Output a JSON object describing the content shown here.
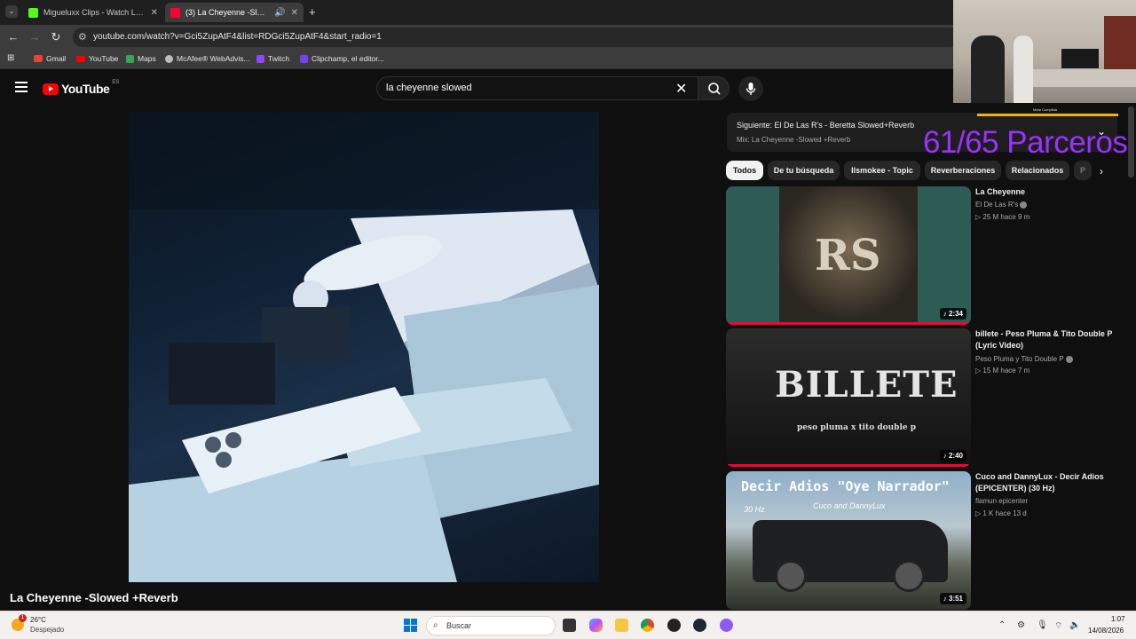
{
  "browser": {
    "tabs": [
      {
        "label": "Migueluxx Clips - Watch Live o",
        "color": "#53fc18"
      },
      {
        "label": "(3) La Cheyenne -Slowed +",
        "color": "#ff0033"
      }
    ],
    "new_tab": "+",
    "url": "youtube.com/watch?v=Gci5ZupAtF4&list=RDGci5ZupAtF4&start_radio=1",
    "bookmarks": [
      "Gmail",
      "YouTube",
      "Maps",
      "McAfee® WebAdvis...",
      "Twitch",
      "Clipchamp, el editor..."
    ]
  },
  "youtube": {
    "logo_text": "YouTube",
    "country_code": "ES",
    "search_value": "la cheyenne slowed",
    "video_title": "La Cheyenne -Slowed +Reverb",
    "up_next": {
      "label": "Siguiente: El De Las R's - Beretta Slowed+Reverb",
      "mix": "Mix: La Cheyenne -Slowed +Reverb"
    },
    "chips": [
      "Todos",
      "De tu búsqueda",
      "Ilsmokee - Topic",
      "Reverberaciones",
      "Relacionados",
      "P"
    ],
    "recommendations": [
      {
        "title": "La Cheyenne",
        "channel": "El De Las R's",
        "meta": "▷ 25 M   hace 9 m",
        "duration": "♪ 2:34",
        "thumb_text": "RS"
      },
      {
        "title": "billete - Peso Pluma & Tito Double P (Lyric Video)",
        "channel": "Peso Pluma  y Tito Double P",
        "meta": "▷ 15 M   hace 7 m",
        "duration": "♪ 2:40",
        "thumb_text": "BILLETE",
        "thumb_sub": "peso pluma x tito double p"
      },
      {
        "title": "Cuco and DannyLux - Decir Adios (EPICENTER) (30 Hz)",
        "channel": "flamun epicenter",
        "meta": "▷ 1 K   hace 13 d",
        "duration": "♪ 3:51",
        "thumb_text": "Decir Adios \"Oye Narrador\"",
        "thumb_sub": "Cuco and DannyLux",
        "thumb_hz": "30 Hz"
      }
    ]
  },
  "stream_overlay": {
    "count": "61/65 Parceros",
    "bar_label": "Meta Cumplida",
    "bar_color": "#f0b400",
    "count_color": "#9b30ff"
  },
  "taskbar": {
    "weather_temp": "26°C",
    "weather_desc": "Despejado",
    "weather_badge": "1",
    "search_placeholder": "Buscar",
    "time": "1:07",
    "date": "14/08/2026"
  }
}
